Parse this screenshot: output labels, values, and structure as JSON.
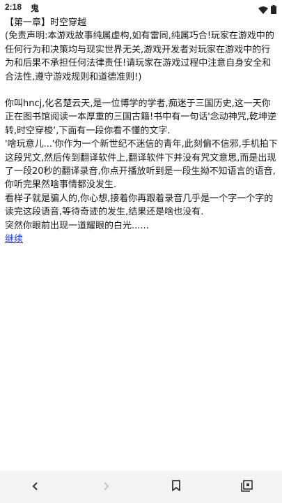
{
  "status_bar": {
    "time": "2:18",
    "app_label": "鬼",
    "icons": [
      "wifi-icon",
      "battery-icon"
    ]
  },
  "content": {
    "chapter_title": "【第一章】时空穿越",
    "disclaimer": "(免责声明:本游戏故事纯属虚构,如有雷同,纯属巧合!玩家在游戏中的任何行为和决策均与现实世界无关,游戏开发者对玩家在游戏中的行为和后果不承担任何法律责任!请玩家在游戏过程中注意自身安全和合法性,遵守游戏规则和道德准则!)",
    "paragraphs": [
      "你叫hncj,化名楚云天,是一位博学的学者,痴迷于三国历史,这一天你正在图书馆阅读一本厚重的三国古籍!书中有一句话'念动神咒,乾坤逆转,时空穿梭‘,下面有一段你看不懂的文字.",
      "'啥玩意儿...'你作为一个新世纪不迷信的青年,此刻偏不信邪,手机拍下这段咒文,然后传到翻译软件上,翻译软件下并没有咒文意思,而是出现了一段20秒的翻译录音,你点开播放听到是一段生拗不知语言的语音,你听完果然啥事情都没发生.",
      "看样子就是骗人的,你心想,接着你再跟着录音几乎是一个字一个字的读完这段语音,等待奇迹的发生,结果还是啥也没有.",
      "突然你眼前出现一道耀眼的白光......"
    ],
    "continue_label": "继续",
    "link_color": "#1a3fc9"
  },
  "nav_bar": {
    "icons": [
      "back-icon",
      "forward-icon",
      "bookmark-icon",
      "tabs-icon"
    ]
  }
}
